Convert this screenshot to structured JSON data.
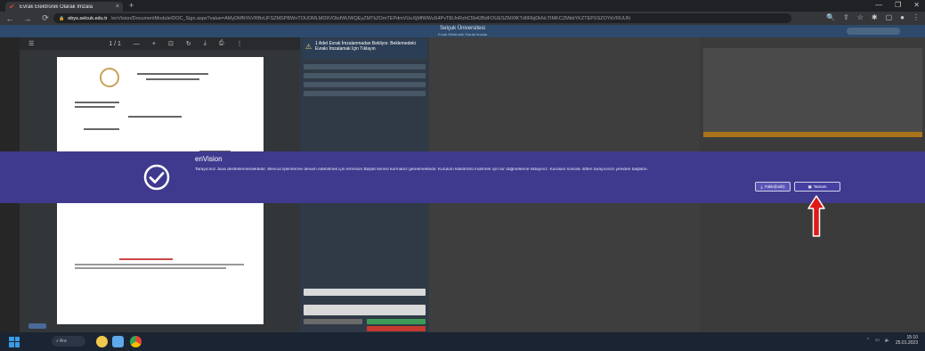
{
  "browser": {
    "tab_title": "Evrak Elektronik Olarak İmzala",
    "close_symbol": "×",
    "newtab_symbol": "+",
    "url_host": "ebys.selcuk.edu.tr",
    "url_path": "/enVision/DocumentModule/DOC_Sign.aspx?value=AMyDMNYkVRBxUFSZMSPBWnTOUOMLMD9VOkdWUWQEyZMTkZOmTEPdmVUuXjMfWWuS4PvT8LfnRzhC5b42BdFOUESZMXfKTd0RbjDkNcTIMKCZMkbYKZTEPXSZOYkVRUUN",
    "back": "←",
    "forward": "→",
    "reload": "⟳",
    "lock": "🔒",
    "window_min": "—",
    "window_max": "❐",
    "window_close": "✕"
  },
  "app": {
    "header_title": "Selçuk Üniversitesi",
    "header_sub": "Evrak Elektronik Olarak İmzala"
  },
  "viewer": {
    "page_indicator": "1 / 1",
    "zoom_minus": "—",
    "zoom_plus": "+",
    "download": "⤓",
    "print": "⎙",
    "more": "⋮"
  },
  "midpanel": {
    "warning_text": "1 Adet Evrak İmzalanmadan Bekliyor. Beklemedeki Evrakı İmzalamak İçin Tıklayın"
  },
  "overlay": {
    "title": "enVision",
    "message": "Tarayıcınız Java desteklememektedir. Mevcut işlemlerine devam edebilmek için enVision Başlat servisi kurmanız gerekmektedir. Kurulum klasörünü indirmek için tur düğmelerine tıklayınız. Kurulum sonrası lütfen tarayıcınızı yeniden başlatın.",
    "btn_download": "Yükle(İndir)",
    "btn_ok": "Tamam"
  },
  "taskbar": {
    "search": "Ara",
    "time": "15:10",
    "date": "25.01.2023"
  },
  "colors": {
    "overlay": "#3f3a8e",
    "arrow": "#e01919"
  }
}
